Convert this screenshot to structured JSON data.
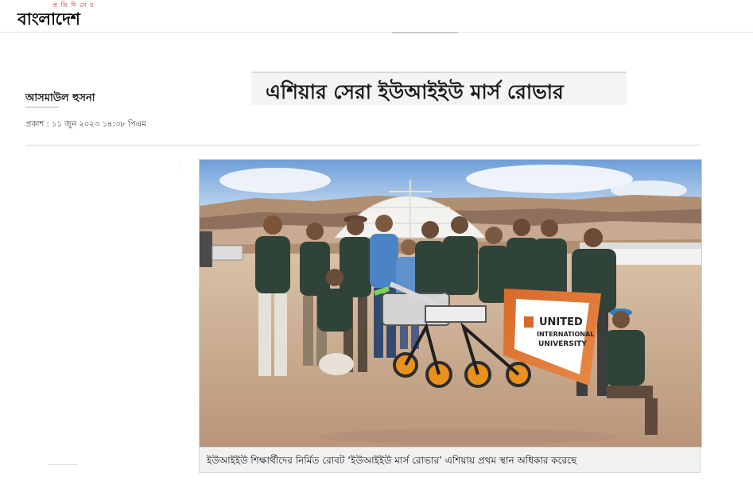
{
  "masthead": {
    "top_text": "প্র তি দি নে র",
    "main_text": "বাংলাদেশ"
  },
  "article": {
    "headline": "এশিয়ার সেরা ইউআইইউ মার্স রোভার",
    "author": "আসমাউল হুসনা",
    "published": "প্রকাশ : ১১ জুন ২০২৩ ১৪:৩৮ পিএম"
  },
  "photo": {
    "flag_text": [
      "UNITED",
      "INTERNATIONAL",
      "UNIVERSITY"
    ],
    "colors": {
      "sky": "#8db8e8",
      "dome": "#f1f1ef",
      "hills": "#b59573",
      "ground": "#c8a486",
      "jersey": "#2f4338",
      "flag_orange": "#e1732a"
    }
  },
  "caption": "ইউআইইউ শিক্ষার্থীদের নির্মিত রোবট ‘ইউআইইউ মার্স রোভার’ এশিয়ায় প্রথম স্থান অধিকার করেছে"
}
